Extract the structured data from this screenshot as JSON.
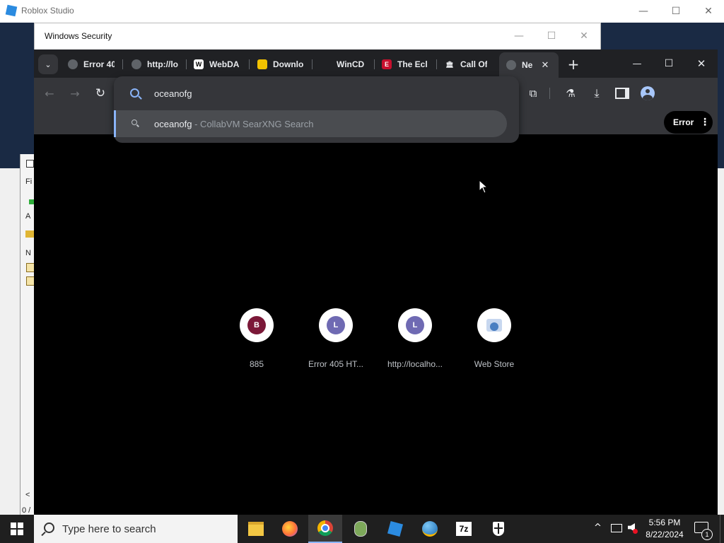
{
  "roblox": {
    "title": "Roblox Studio"
  },
  "window_controls": {
    "minimize": "—",
    "maximize": "☐",
    "close": "✕"
  },
  "side_panel": {
    "glyphs": [
      "Fi",
      "A",
      "N"
    ],
    "bottom": "0 /",
    "arrow": "<"
  },
  "winsec": {
    "title": "Windows Security"
  },
  "tabs": [
    {
      "label": "Error 40",
      "icon": "globe-icon"
    },
    {
      "label": "http://lo",
      "icon": "globe-icon"
    },
    {
      "label": "WebDA",
      "icon": "wikipedia-icon",
      "icon_text": "W"
    },
    {
      "label": "Downlo",
      "icon": "yellow-app-icon"
    },
    {
      "label": "WinCD",
      "icon": "blank-icon"
    },
    {
      "label": "The Ecl",
      "icon": "red-game-icon",
      "icon_text": "E"
    },
    {
      "label": "Call Of",
      "icon": "institution-icon",
      "icon_text": "🏛"
    }
  ],
  "active_tab": {
    "label": "Ne",
    "icon": "globe-icon"
  },
  "new_tab_symbol": "+",
  "omnibox": {
    "query": "oceanofg",
    "suggestion_query": "oceanofg",
    "suggestion_source": " - CollabVM SearXNG Search"
  },
  "profile": {
    "label": "Error"
  },
  "shortcuts": [
    {
      "letter": "B",
      "label": "885",
      "color": "#7b1838"
    },
    {
      "letter": "L",
      "label": "Error 405 HT...",
      "color": "#6f6ab3"
    },
    {
      "letter": "L",
      "label": "http://localho...",
      "color": "#6f6ab3"
    },
    {
      "letter": "",
      "label": "Web Store",
      "color": "#4a7fc1"
    }
  ],
  "taskbar": {
    "search_placeholder": "Type here to search",
    "time": "5:56 PM",
    "date": "8/22/2024",
    "notification_count": "1"
  },
  "colors": {
    "accent": "#8ab4f8",
    "chrome_bg": "#202124",
    "toolbar_bg": "#35363a"
  }
}
